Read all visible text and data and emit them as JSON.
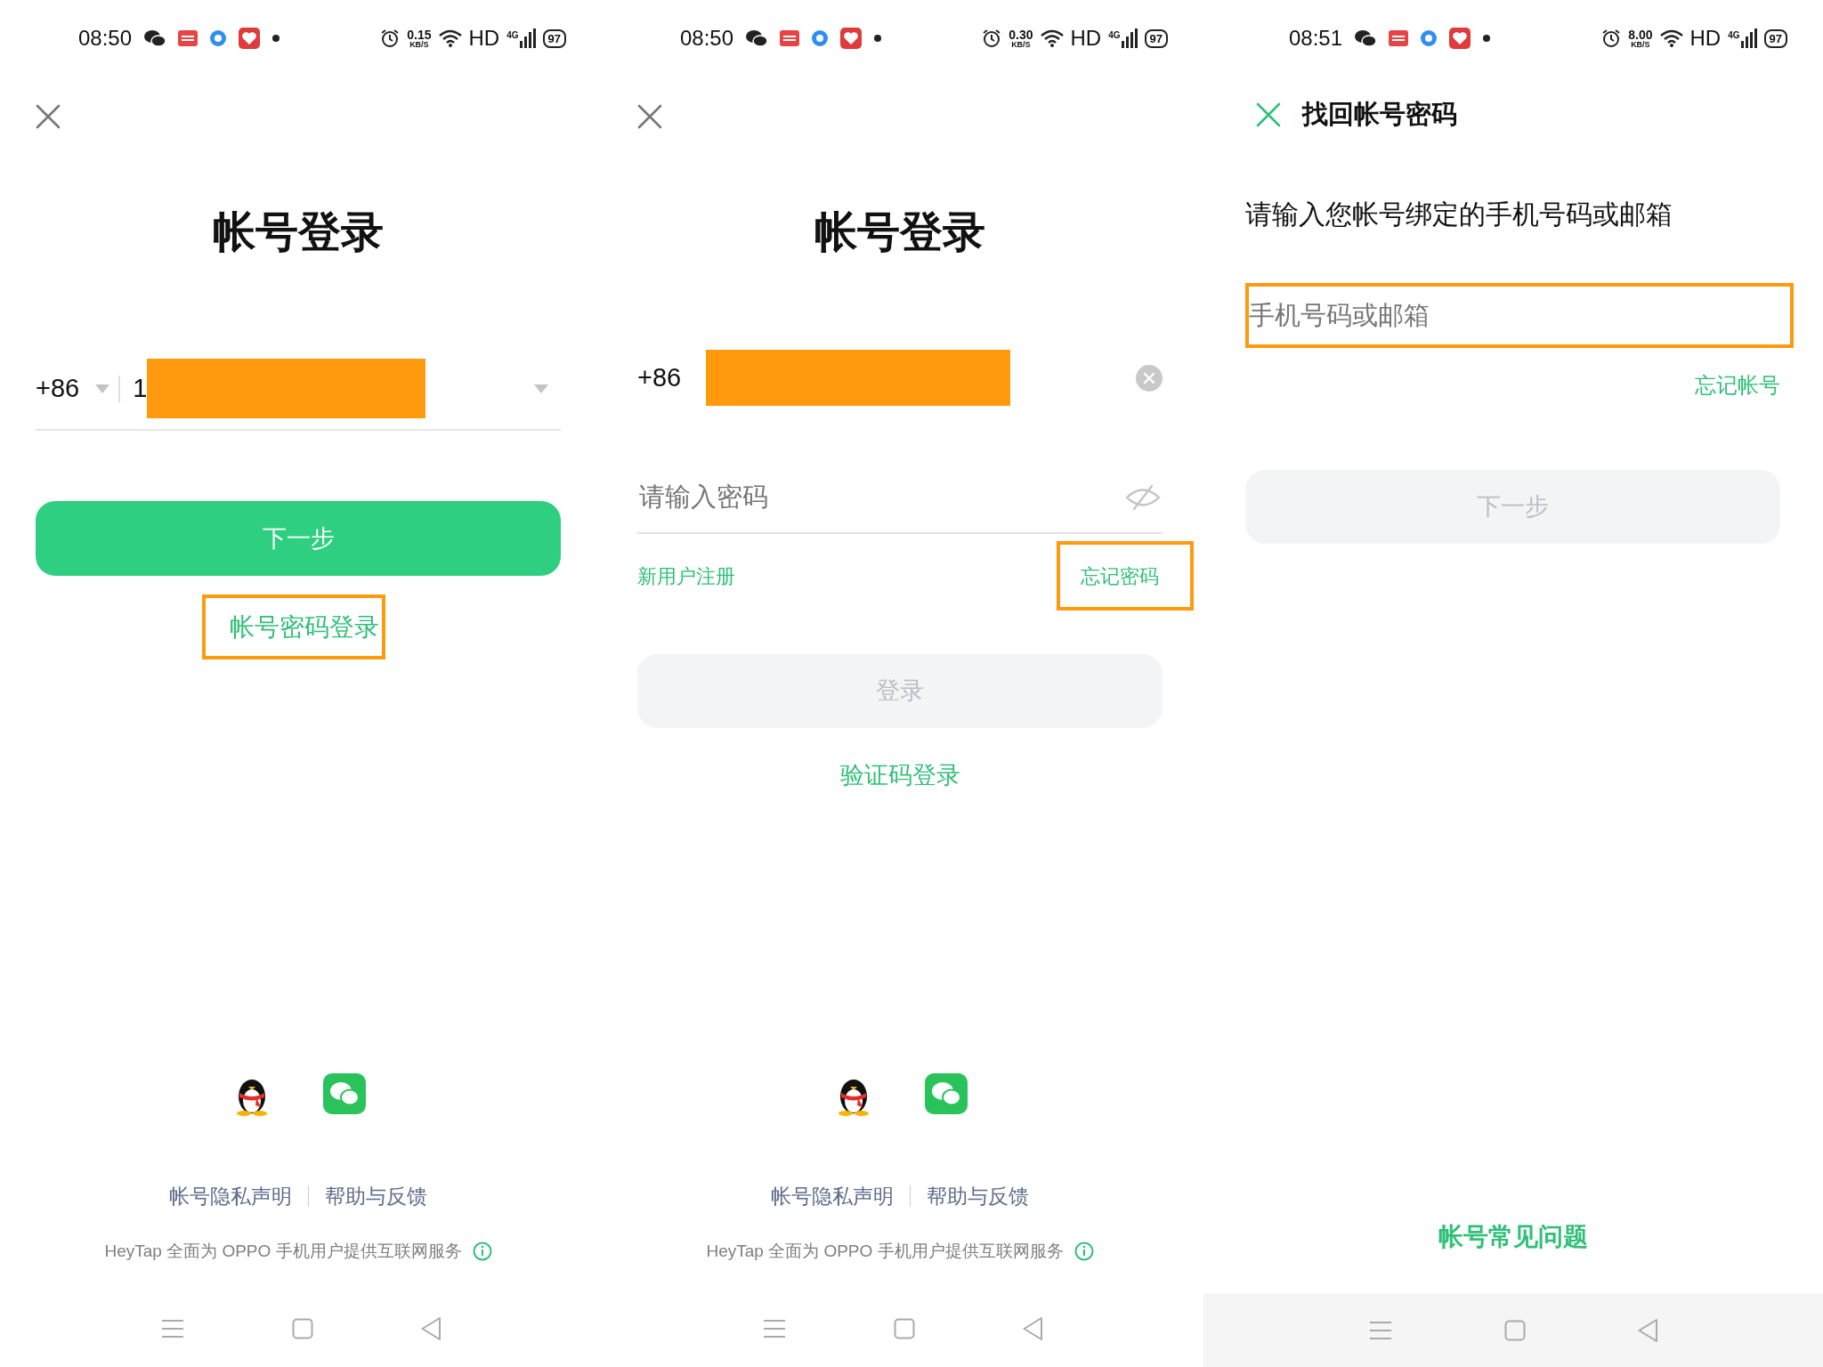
{
  "panels": [
    {
      "kind": "sms_login",
      "status_bar": {
        "time": "08:50",
        "speed": "0.15",
        "speed_unit": "KB/S",
        "hd": "HD",
        "network": "4G",
        "battery": "97"
      },
      "title": "帐号登录",
      "phone": {
        "country_code": "+86",
        "value": "1",
        "redacted": true
      },
      "primary_button": {
        "label": "下一步",
        "disabled": false
      },
      "alt_link": {
        "label": "帐号密码登录",
        "highlighted": true
      },
      "footer_links": [
        "帐号隐私声明",
        "帮助与反馈"
      ],
      "service_note": "HeyTap 全面为 OPPO 手机用户提供互联网服务"
    },
    {
      "kind": "password_login",
      "status_bar": {
        "time": "08:50",
        "speed": "0.30",
        "speed_unit": "KB/S",
        "hd": "HD",
        "network": "4G",
        "battery": "97"
      },
      "title": "帐号登录",
      "phone": {
        "country_code": "+86",
        "redacted": true
      },
      "password": {
        "placeholder": "请输入密码"
      },
      "register_link": {
        "label": "新用户注册"
      },
      "forgot_link": {
        "label": "忘记密码",
        "highlighted": true
      },
      "primary_button": {
        "label": "登录",
        "disabled": true
      },
      "alt_link": {
        "label": "验证码登录",
        "highlighted": false
      },
      "footer_links": [
        "帐号隐私声明",
        "帮助与反馈"
      ],
      "service_note": "HeyTap 全面为 OPPO 手机用户提供互联网服务"
    },
    {
      "kind": "recover",
      "status_bar": {
        "time": "08:51",
        "speed": "8.00",
        "speed_unit": "KB/S",
        "hd": "HD",
        "network": "4G",
        "battery": "97"
      },
      "title": "找回帐号密码",
      "prompt": "请输入您帐号绑定的手机号码或邮箱",
      "account_field": {
        "placeholder": "手机号码或邮箱",
        "highlighted": true
      },
      "forgot_link": {
        "label": "忘记帐号"
      },
      "primary_button": {
        "label": "下一步",
        "disabled": true
      },
      "faq_link": "帐号常见问题"
    }
  ]
}
